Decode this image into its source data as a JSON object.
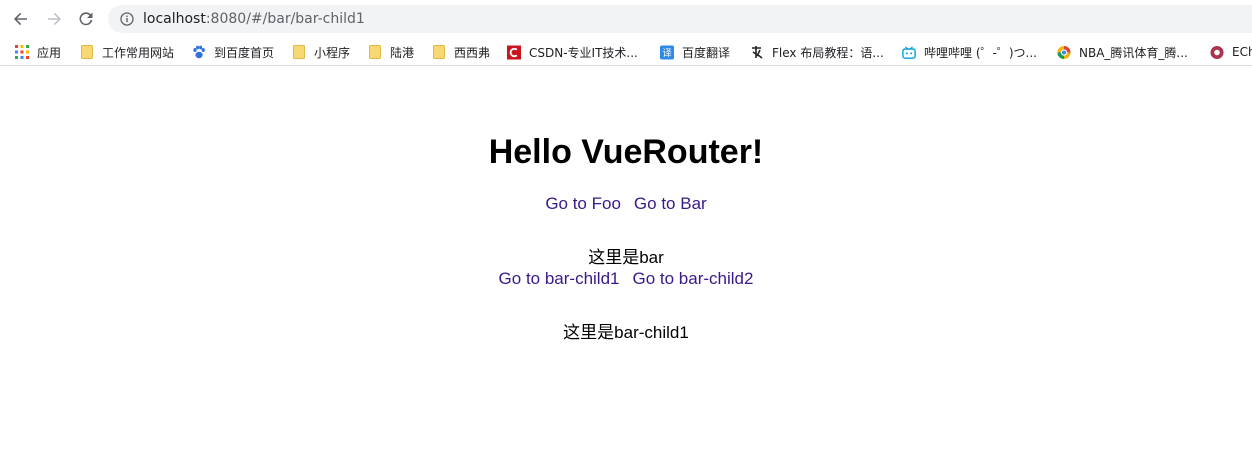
{
  "browser": {
    "url_host": "localhost",
    "url_rest": ":8080/#/bar/bar-child1"
  },
  "bookmarks": [
    {
      "label": "应用",
      "icon": "apps-grid-icon"
    },
    {
      "label": "工作常用网站",
      "icon": "folder-icon"
    },
    {
      "label": "到百度首页",
      "icon": "baidu-paw-icon"
    },
    {
      "label": "小程序",
      "icon": "folder-icon"
    },
    {
      "label": "陆港",
      "icon": "folder-icon"
    },
    {
      "label": "西西弗",
      "icon": "folder-icon"
    },
    {
      "label": "CSDN-专业IT技术...",
      "icon": "csdn-icon"
    },
    {
      "label": "百度翻译",
      "icon": "baidu-translate-icon"
    },
    {
      "label": "Flex 布局教程：语...",
      "icon": "ruanyifeng-icon"
    },
    {
      "label": "哔哩哔哩 (゜-゜)つ...",
      "icon": "bilibili-icon"
    },
    {
      "label": "NBA_腾讯体育_腾...",
      "icon": "tencent-sports-icon"
    },
    {
      "label": "ECh",
      "icon": "echarts-icon"
    }
  ],
  "page": {
    "title": "Hello VueRouter!",
    "links": [
      "Go to Foo",
      "Go to Bar"
    ],
    "bar_text": "这里是bar",
    "child_links": [
      "Go to bar-child1",
      "Go to bar-child2"
    ],
    "child_text": "这里是bar-child1"
  },
  "colors": {
    "link": "#3a1a8a",
    "omnibox_bg": "#f1f3f4",
    "folder": "#f8d775"
  }
}
